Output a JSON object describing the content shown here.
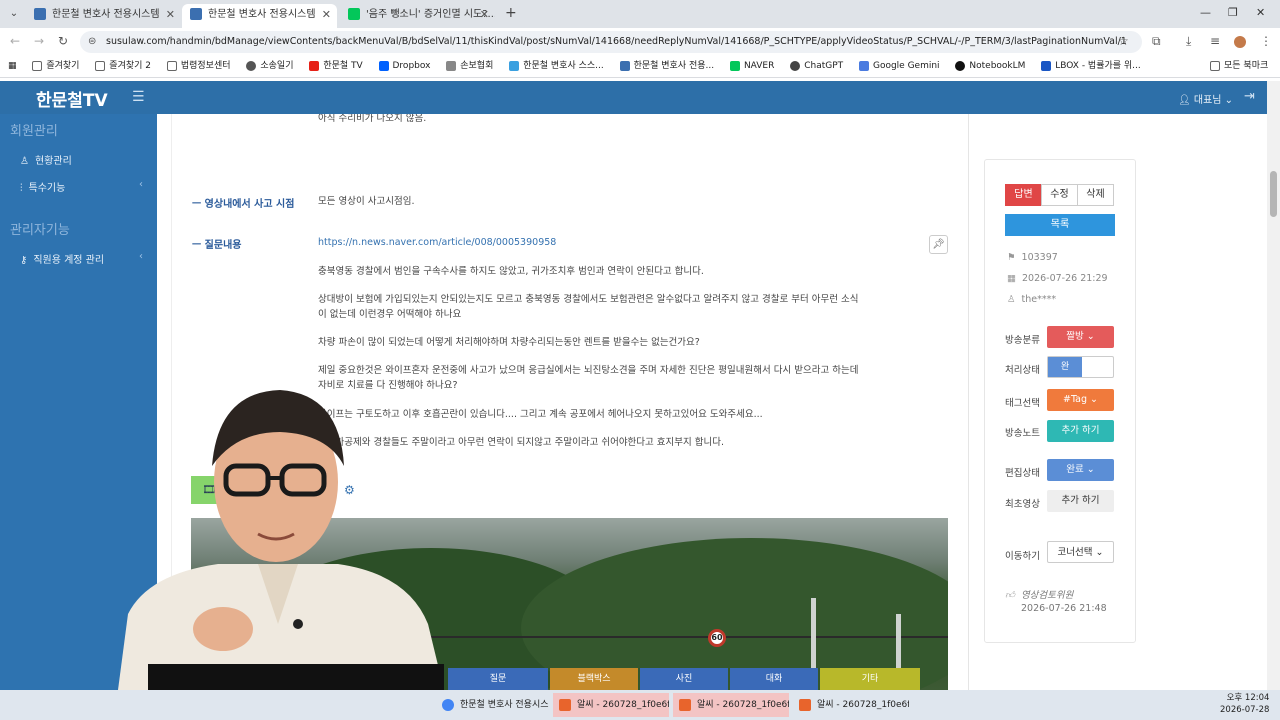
{
  "browser": {
    "tabs": [
      {
        "label": "한문철 변호사 전용시스템",
        "active": false
      },
      {
        "label": "한문철 변호사 전용시스템",
        "active": true
      },
      {
        "label": "'음주 뺑소니' 증거인멸 시도?...",
        "active": false
      }
    ],
    "new_tab": "+",
    "url": "susulaw.com/handmin/bdManage/viewContents/backMenuVal/B/bdSelVal/11/thisKindVal/post/sNumVal/141668/needReplyNumVal/141668/P_SCHTYPE/applyVideoStatus/P_SCHVAL/-/P_TERM/3/lastPaginationNumVal/1",
    "bookmarks": [
      "즐겨찾기",
      "즐겨찾기 2",
      "법령정보센터",
      "소송일기",
      "한문철 TV",
      "Dropbox",
      "손보협회",
      "한문철 변호사 스스...",
      "한문철 변호사 전용...",
      "NAVER",
      "ChatGPT",
      "Google Gemini",
      "NotebookLM",
      "LBOX - 법률가를 위..."
    ],
    "all_bookmarks": "모든 북마크"
  },
  "app": {
    "logo": "한문철TV",
    "user": "대표님",
    "sidebar": {
      "sections": [
        {
          "title": "회원관리",
          "items": [
            {
              "label": "현황관리"
            },
            {
              "label": "특수기능"
            }
          ]
        },
        {
          "title": "관리자기능",
          "items": [
            {
              "label": "직원용 계정 관리"
            }
          ]
        }
      ]
    }
  },
  "post": {
    "top_text": "아직 수리비가 나오지 않음.",
    "fields": [
      {
        "label": "ㅡ 영상내에서 사고 시점",
        "value": "모든 영상이 사고시점임."
      },
      {
        "label": "ㅡ 질문내용",
        "link": "https://n.news.naver.com/article/008/0005390958"
      }
    ],
    "paragraphs": [
      "충북영동 경찰에서 범인을 구속수사를 하지도 않았고, 귀가조치후 범인과 연락이 안된다고 합니다.",
      "상대방이 보험에 가입되있는지 안되있는지도 모르고 충북영동 경찰에서도 보험관련은 알수없다고 알려주지 않고 경찰로 부터 아무런 소식이 없는데 이런경우 어떡해야 하나요",
      "차량 파손이 많이 되었는데 어떻게 처리해야하며 차량수리되는동안 렌트를 받을수는 없는건가요?",
      "제일 중요한것은 와이프혼자 운전중에 사고가 났으며 응급실에서는 뇌진탕소견을 주며 자세한 진단은 평일내원해서 다시 받으라고 하는데 자비로 치료를 다 진행해야 하나요?",
      "와이프는 구토도하고 이후 호흡곤란이 있습니다.... 그리고 계속 공포에서 헤어나오지 못하고있어요 도와주세요...",
      "렌터카공제와 경찰들도 주말이라고 아무런 연락이 되지않고 주말이라고 쉬어야한다고 효지부지 합니다."
    ],
    "media_count": "1",
    "video_tabs": [
      "질문",
      "블랙박스",
      "사진",
      "대화",
      "기타"
    ],
    "speed_sign": "60"
  },
  "panel": {
    "buttons": {
      "answer": "답변",
      "edit": "수정",
      "delete": "삭제",
      "list": "목록"
    },
    "post_id": "103397",
    "date": "2026-07-26 21:29",
    "author": "the****",
    "rows": [
      {
        "label": "방송분류",
        "value": "짤방",
        "color": "#e45b5b"
      },
      {
        "label": "처리상태",
        "value": "완",
        "type": "toggle"
      },
      {
        "label": "태그선택",
        "value": "#Tag",
        "color": "#f07a3c"
      },
      {
        "label": "방송노트",
        "value": "추가 하기",
        "color": "#2eb8b4"
      },
      {
        "label": "편집상태",
        "value": "완료",
        "color": "#5b8ed6"
      },
      {
        "label": "최초영상",
        "value": "추가 하기",
        "color": "#eeeeee"
      },
      {
        "label": "이동하기",
        "value": "코너선택",
        "type": "select"
      }
    ],
    "reviewer": "영상검토위원",
    "review_date": "2026-07-26 21:48"
  },
  "taskbar": {
    "items": [
      "한문철 변호사 전용시스",
      "알씨 - 260728_1f0e6fe5-",
      "알씨 - 260728_1f0e6fe5-",
      "알씨 - 260728_1f0e6fe5-"
    ],
    "time": "오후 12:04",
    "date": "2026-07-28"
  }
}
